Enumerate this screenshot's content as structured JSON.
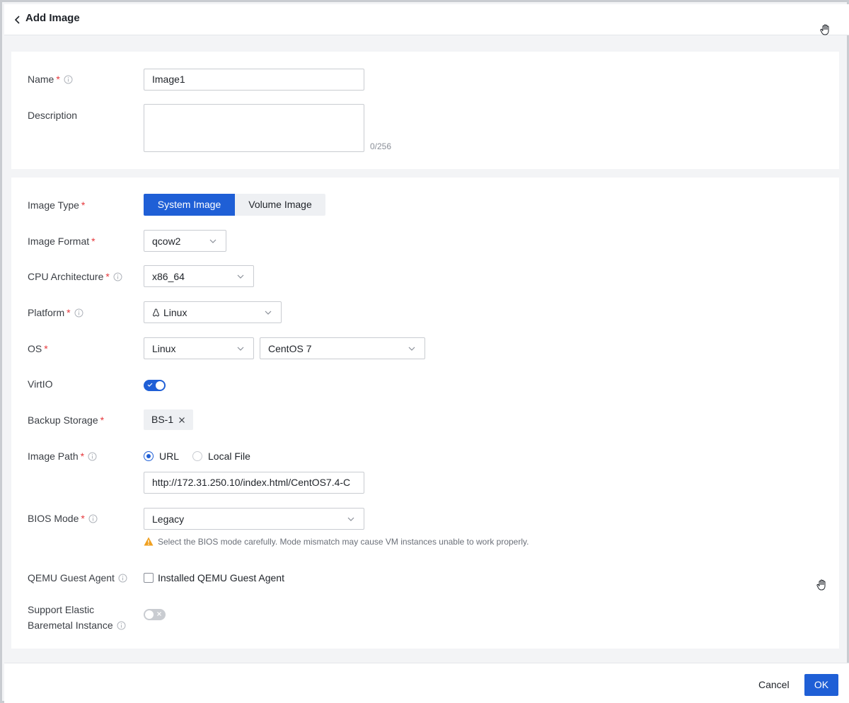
{
  "header": {
    "title": "Add Image"
  },
  "basic": {
    "name_label": "Name",
    "name_value": "Image1",
    "description_label": "Description",
    "description_counter": "0/256"
  },
  "config": {
    "required_mark": "*",
    "image_type": {
      "label": "Image Type",
      "options": [
        "System Image",
        "Volume Image"
      ],
      "selected": "System Image"
    },
    "image_format": {
      "label": "Image Format",
      "value": "qcow2"
    },
    "cpu_architecture": {
      "label": "CPU Architecture",
      "value": "x86_64"
    },
    "platform": {
      "label": "Platform",
      "value": "Linux"
    },
    "os": {
      "label": "OS",
      "type_value": "Linux",
      "version_value": "CentOS 7"
    },
    "virtio": {
      "label": "VirtIO",
      "enabled": true
    },
    "backup_storage": {
      "label": "Backup Storage",
      "tag": "BS-1"
    },
    "image_path": {
      "label": "Image Path",
      "option_url": "URL",
      "option_local": "Local File",
      "selected": "URL",
      "url_value": "http://172.31.250.10/index.html/CentOS7.4-C"
    },
    "bios_mode": {
      "label": "BIOS Mode",
      "value": "Legacy",
      "warning": "Select the BIOS mode carefully. Mode mismatch may cause VM instances unable to work properly."
    },
    "qemu_agent": {
      "label": "QEMU Guest Agent",
      "checkbox_label": "Installed QEMU Guest Agent",
      "checked": false
    },
    "elastic_baremetal": {
      "label_line1": "Support Elastic",
      "label_line2": "Baremetal Instance",
      "enabled": false
    }
  },
  "footer": {
    "cancel_label": "Cancel",
    "ok_label": "OK"
  },
  "colors": {
    "primary": "#1f5fd6",
    "required": "#e6373b",
    "warning": "#f0a020"
  }
}
